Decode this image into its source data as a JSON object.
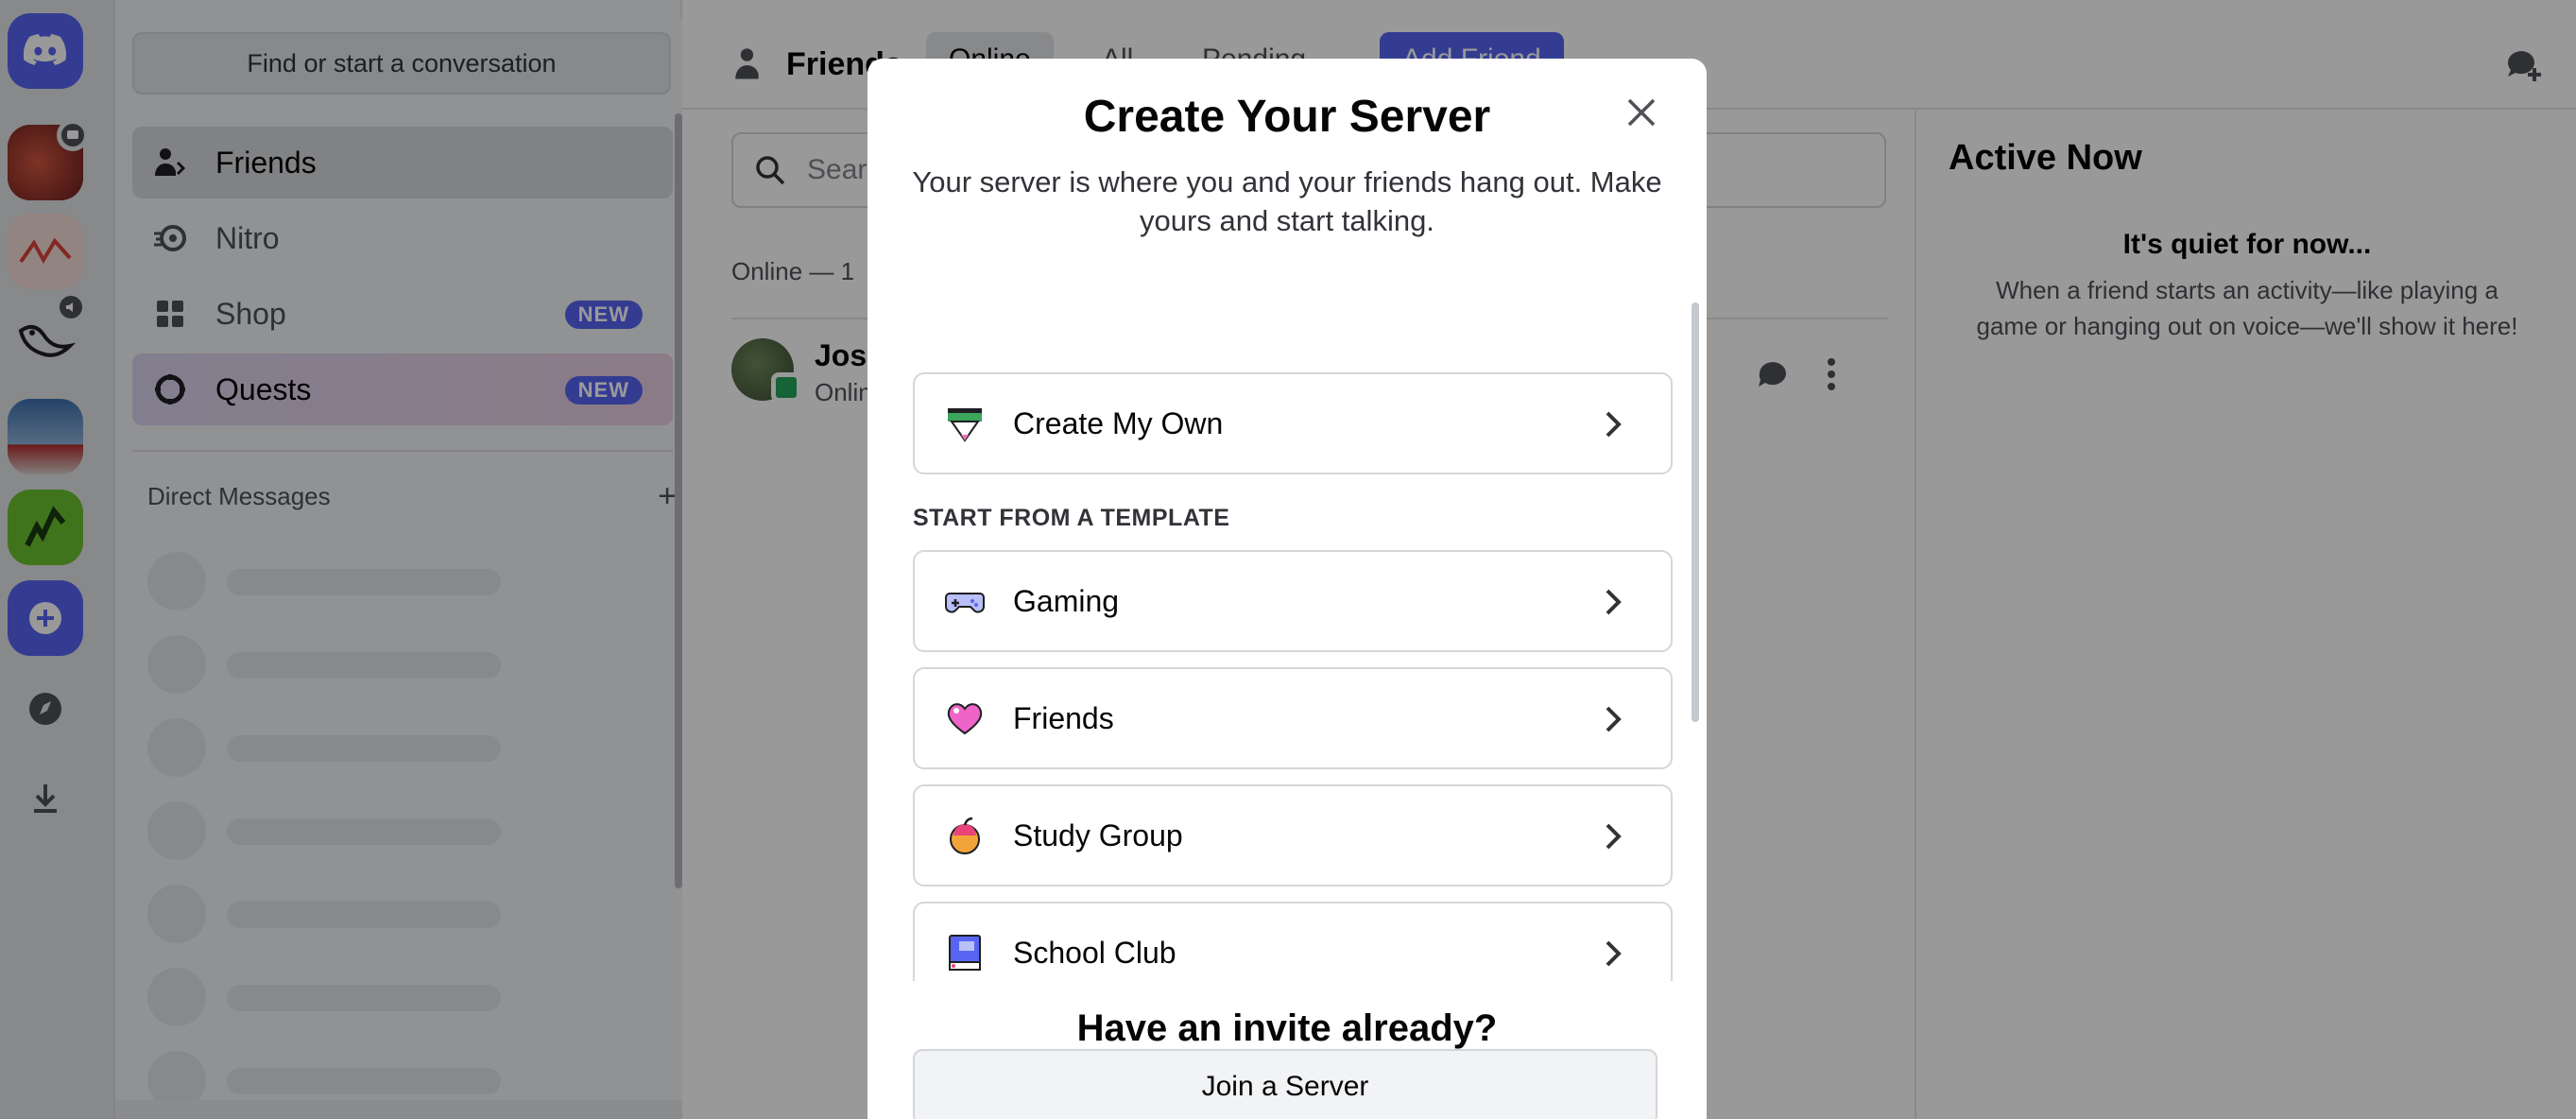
{
  "sidebar": {
    "find_placeholder": "Find or start a conversation",
    "nav": [
      {
        "label": "Friends",
        "icon": "friends-icon"
      },
      {
        "label": "Nitro",
        "icon": "nitro-icon"
      },
      {
        "label": "Shop",
        "icon": "shop-icon",
        "badge": "NEW"
      },
      {
        "label": "Quests",
        "icon": "quests-icon",
        "badge": "NEW"
      }
    ],
    "dm_header": "Direct Messages",
    "dm_add": "+"
  },
  "main": {
    "title": "Friends",
    "tabs": [
      "Online",
      "All",
      "Pending",
      "Add Friend"
    ],
    "search_placeholder": "Search",
    "online_count": "Online — 1",
    "friend": {
      "name": "Josh",
      "status": "Online"
    }
  },
  "active_now": {
    "title": "Active Now",
    "quiet_title": "It's quiet for now...",
    "quiet_body": "When a friend starts an activity—like playing a game or hanging out on voice—we'll show it here!"
  },
  "modal": {
    "title": "Create Your Server",
    "subtitle": "Your server is where you and your friends hang out. Make yours and start talking.",
    "create_own": "Create My Own",
    "template_label": "START FROM A TEMPLATE",
    "templates": [
      "Gaming",
      "Friends",
      "Study Group",
      "School Club"
    ],
    "invite_title": "Have an invite already?",
    "join_button": "Join a Server"
  },
  "colors": {
    "brand": "#5865f2",
    "online": "#23a55a"
  }
}
